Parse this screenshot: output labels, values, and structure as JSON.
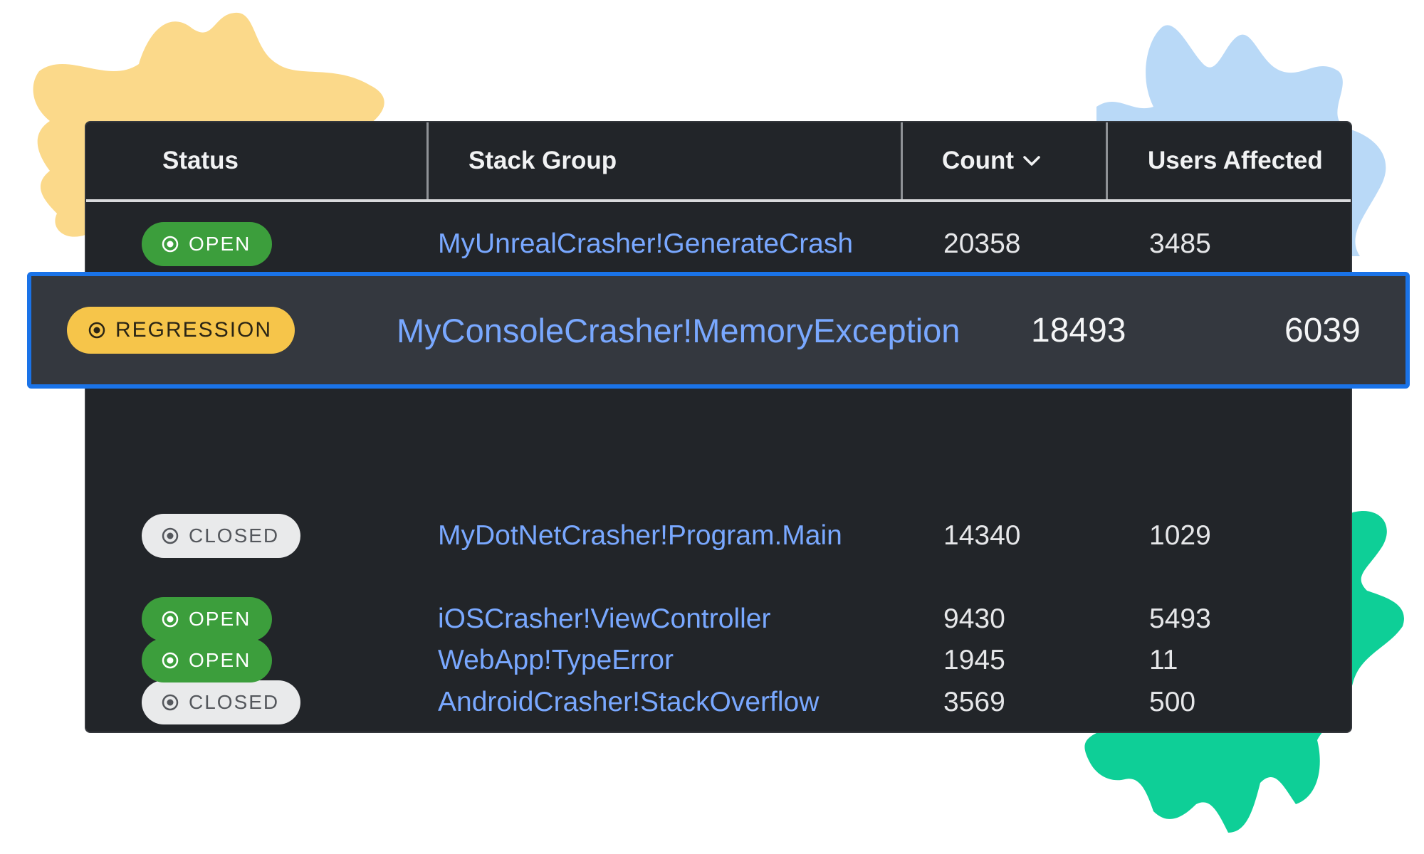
{
  "colors": {
    "panel_bg": "#222529",
    "link": "#79a8ff",
    "open_badge": "#3c9e3c",
    "closed_badge": "#e9eaeb",
    "regression_badge": "#f6c54a",
    "highlight_border": "#1a73e8",
    "splat_yellow": "#fbd98a",
    "splat_blue": "#b9d9f7",
    "splat_green": "#0ecf97"
  },
  "table": {
    "headers": {
      "status": "Status",
      "stack_group": "Stack Group",
      "count": "Count",
      "users_affected": "Users Affected"
    },
    "sort_icon": "chevron-down-icon",
    "rows": [
      {
        "status": "OPEN",
        "stack_group": "MyUnrealCrasher!GenerateCrash",
        "count": "20358",
        "users": "3485"
      },
      {
        "status": "REGRESSION",
        "stack_group": "MyConsoleCrasher!MemoryException",
        "count": "18493",
        "users": "6039",
        "highlighted": true
      },
      {
        "status": "CLOSED",
        "stack_group": "MyDotNetCrasher!Program.Main",
        "count": "14340",
        "users": "1029"
      },
      {
        "status": "OPEN",
        "stack_group": "iOSCrasher!ViewController",
        "count": "9430",
        "users": "5493"
      },
      {
        "status": "CLOSED",
        "stack_group": "AndroidCrasher!StackOverflow",
        "count": "3569",
        "users": "500"
      },
      {
        "status": "OPEN",
        "stack_group": "WebApp!TypeError",
        "count": "1945",
        "users": "11"
      }
    ]
  }
}
